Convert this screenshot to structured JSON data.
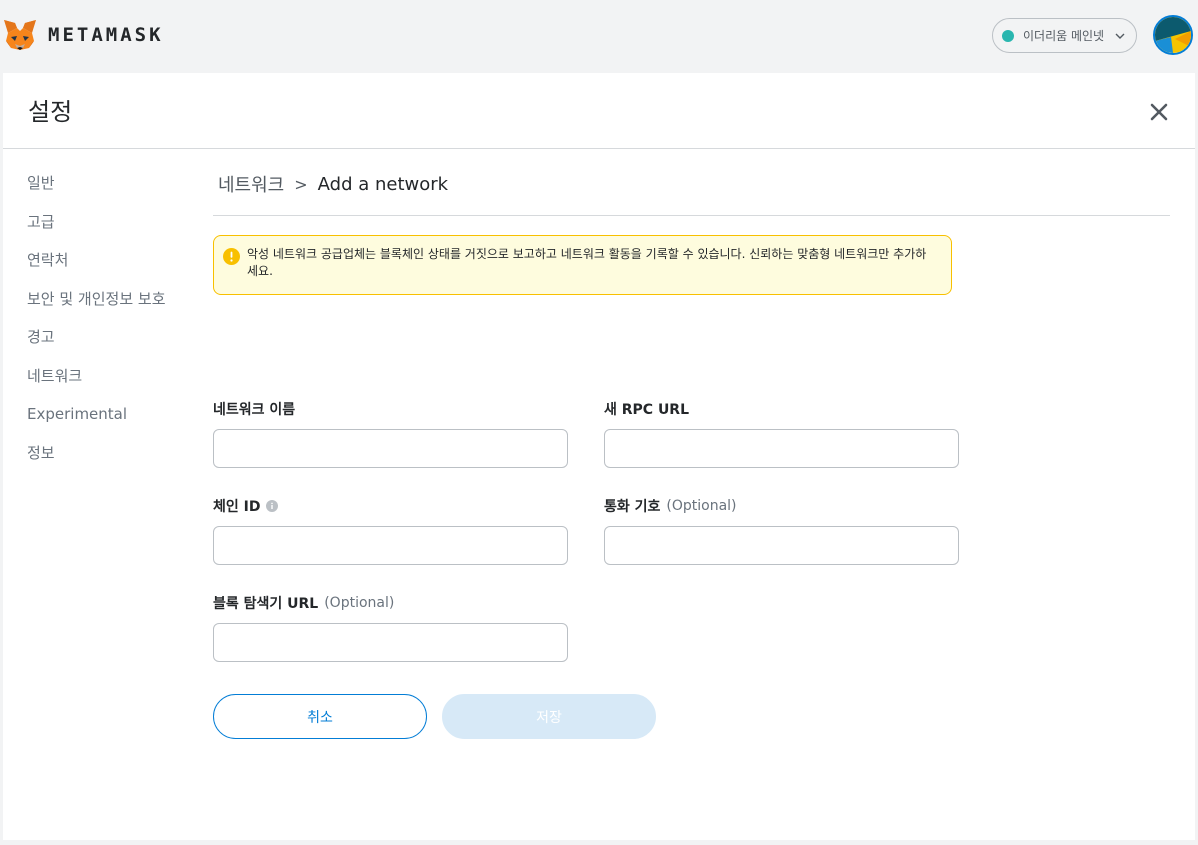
{
  "header": {
    "brand": "METAMASK",
    "network": {
      "label": "이더리움 메인넷",
      "dot_color": "#29b6af"
    }
  },
  "settings": {
    "title": "설정",
    "sidebar": [
      {
        "label": "일반"
      },
      {
        "label": "고급"
      },
      {
        "label": "연락처"
      },
      {
        "label": "보안 및 개인정보 보호"
      },
      {
        "label": "경고"
      },
      {
        "label": "네트워크"
      },
      {
        "label": "Experimental"
      },
      {
        "label": "정보"
      }
    ]
  },
  "breadcrumb": {
    "parent": "네트워크",
    "separator": ">",
    "current": "Add a network"
  },
  "warning": {
    "text": "악성 네트워크 공급업체는 블록체인 상태를 거짓으로 보고하고 네트워크 활동을 기록할 수 있습니다. 신뢰하는 맞춤형 네트워크만 추가하세요."
  },
  "form": {
    "network_name": {
      "label": "네트워크 이름",
      "value": ""
    },
    "rpc_url": {
      "label": "새 RPC URL",
      "value": ""
    },
    "chain_id": {
      "label": "체인 ID",
      "value": ""
    },
    "currency_symbol": {
      "label": "통화 기호",
      "optional": "(Optional)",
      "value": ""
    },
    "block_explorer": {
      "label": "블록 탐색기 URL",
      "optional": "(Optional)",
      "value": ""
    }
  },
  "buttons": {
    "cancel": "취소",
    "save": "저장"
  },
  "colors": {
    "accent": "#037dd6",
    "warning_bg": "#fefcde",
    "warning_border": "#f8c000",
    "save_disabled": "#d7e9f7"
  }
}
